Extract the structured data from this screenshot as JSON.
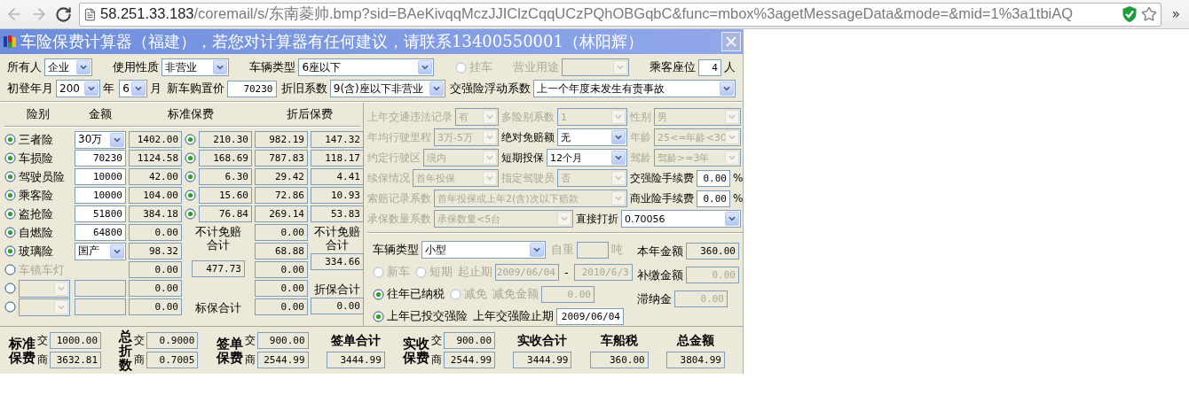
{
  "browser": {
    "url_host": "58.251.33.183",
    "url_path": "/coremail/s/东南菱帅.bmp?sid=BAeKivqqMczJJIClzCqqUCzPQhOBGqbC&func=mbox%3agetMessageData&mode=&mid=1%3a1tbiAQ",
    "overflow": "»"
  },
  "window": {
    "title": "车险保费计算器（福建），若您对计算器有任何建议，请联系13400550001（林阳辉）"
  },
  "vehicle": {
    "lines": [
      [
        {
          "kind": "select",
          "label": "所有人",
          "value": "企业",
          "disabled": false
        },
        {
          "kind": "select",
          "label": "使用性质",
          "value": "非营业",
          "disabled": false
        },
        {
          "kind": "select",
          "label": "车辆类型",
          "value": "6座以下",
          "disabled": false
        },
        {
          "kind": "radio",
          "label": "挂车",
          "selected": false,
          "disabled": true
        },
        {
          "kind": "select",
          "label": "营业用途",
          "disabled": true
        },
        {
          "kind": "input",
          "label": "乘客座位",
          "value": "4",
          "suffix": "人",
          "disabled": false
        }
      ],
      [
        {
          "kind": "select",
          "label": "初登年月",
          "value": "200",
          "suffix": "年",
          "disabled": false
        },
        {
          "kind": "select",
          "value": "6",
          "suffix": "月",
          "disabled": false
        },
        {
          "kind": "input",
          "label": "新车购置价",
          "value": "70230",
          "disabled": false
        },
        {
          "kind": "select",
          "label": "折旧系数",
          "value": "9(含)座以下非营业",
          "disabled": false
        },
        {
          "kind": "select",
          "label": "交强险浮动系数",
          "value": "上一个年度未发生有责事故",
          "disabled": false
        }
      ]
    ]
  },
  "coverage_table": {
    "columns": [
      "险别",
      "金额",
      "标准保费",
      "折后保费"
    ]
  },
  "coverages": [
    {
      "kind": "named",
      "name": "三者险",
      "selected": true,
      "disabled": false,
      "amount": {
        "kind": "select",
        "value": "30万"
      },
      "standard": "1402.00",
      "discount": {
        "selected": true,
        "value": "210.30"
      },
      "after": "982.19",
      "after_extra": "147.32"
    },
    {
      "kind": "named",
      "name": "车损险",
      "selected": true,
      "disabled": false,
      "amount": {
        "kind": "input",
        "value": "70230"
      },
      "standard": "1124.58",
      "discount": {
        "selected": true,
        "value": "168.69"
      },
      "after": "787.83",
      "after_extra": "118.17"
    },
    {
      "kind": "named",
      "name": "驾驶员险",
      "selected": true,
      "disabled": false,
      "amount": {
        "kind": "input",
        "value": "10000"
      },
      "standard": "42.00",
      "discount": {
        "selected": true,
        "value": "6.30"
      },
      "after": "29.42",
      "after_extra": "4.41"
    },
    {
      "kind": "named",
      "name": "乘客险",
      "selected": true,
      "disabled": false,
      "amount": {
        "kind": "input",
        "value": "10000"
      },
      "standard": "104.00",
      "discount": {
        "selected": true,
        "value": "15.60"
      },
      "after": "72.86",
      "after_extra": "10.93"
    },
    {
      "kind": "named",
      "name": "盗抢险",
      "selected": true,
      "disabled": false,
      "amount": {
        "kind": "input",
        "value": "51800"
      },
      "standard": "384.18",
      "discount": {
        "selected": true,
        "value": "76.84"
      },
      "after": "269.14",
      "after_extra": "53.83"
    },
    {
      "kind": "named",
      "name": "自燃险",
      "selected": true,
      "disabled": false,
      "amount": {
        "kind": "input",
        "value": "64800"
      },
      "standard": "0.00",
      "after": "0.00"
    },
    {
      "kind": "named",
      "name": "玻璃险",
      "selected": true,
      "disabled": false,
      "amount": {
        "kind": "select",
        "value": "国产"
      },
      "standard": "98.32",
      "after": "68.88"
    },
    {
      "kind": "named",
      "name": "车镜车灯",
      "selected": false,
      "disabled": true,
      "amount": {
        "kind": "none"
      },
      "standard": "0.00",
      "after": "0.00"
    },
    {
      "kind": "custom",
      "selected": false,
      "disabled": true,
      "amount": {
        "kind": "blank"
      },
      "standard": "0.00",
      "after": "0.00"
    },
    {
      "kind": "custom",
      "selected": false,
      "disabled": true,
      "amount": {
        "kind": "blank"
      },
      "standard": "0.00",
      "after": "0.00"
    }
  ],
  "standard_summary": {
    "label": "不计免赔合计",
    "value": "477.73",
    "total_label": "标保合计"
  },
  "after_summary": {
    "label": "不计免赔合计",
    "value": "334.66",
    "total_label": "折保合计",
    "total_value": "0.00"
  },
  "params": {
    "lines": [
      [
        {
          "kind": "select",
          "label": "上年交通违法记录",
          "value": "有",
          "disabled": true
        },
        {
          "kind": "select",
          "label": "多险别系数",
          "value": "1",
          "disabled": true
        },
        {
          "kind": "select",
          "label": "性别",
          "value": "男",
          "disabled": true
        }
      ],
      [
        {
          "kind": "select",
          "label": "年均行驶里程",
          "value": "3万-5万",
          "disabled": true
        },
        {
          "kind": "select",
          "label": "绝对免赔额",
          "value": "无",
          "disabled": false
        },
        {
          "kind": "select",
          "label": "年龄",
          "value": "25<=年龄<30",
          "disabled": true
        }
      ],
      [
        {
          "kind": "select",
          "label": "约定行驶区",
          "value": "境内",
          "disabled": true
        },
        {
          "kind": "select",
          "label": "短期投保",
          "value": "12个月",
          "disabled": false
        },
        {
          "kind": "select",
          "label": "驾龄",
          "value": "驾龄>=3年",
          "disabled": true
        }
      ],
      [
        {
          "kind": "select",
          "label": "续保情况",
          "value": "首年投保",
          "disabled": true
        },
        {
          "kind": "select",
          "label": "指定驾驶员",
          "value": "否",
          "disabled": true
        },
        {
          "kind": "input",
          "label": "交强险手续费",
          "value": "0.00",
          "suffix": "%",
          "disabled": false
        }
      ],
      [
        {
          "kind": "select",
          "label": "索赔记录系数",
          "value": "首年投保或上年2(含)次以下赔款",
          "disabled": true
        },
        {
          "kind": "input",
          "label": "商业险手续费",
          "value": "0.00",
          "suffix": "%",
          "disabled": false
        }
      ],
      [
        {
          "kind": "select",
          "label": "承保数量系数",
          "value": "承保数量<5台",
          "disabled": true
        },
        {
          "kind": "select",
          "label": "直接打折",
          "value": "0.70056",
          "disabled": false
        }
      ]
    ]
  },
  "tax": {
    "lines": [
      [
        {
          "kind": "select",
          "label": "车辆类型",
          "value": "小型",
          "disabled": false
        },
        {
          "kind": "input",
          "label": "自重",
          "suffix": "吨",
          "disabled": true
        }
      ],
      [
        {
          "kind": "radio",
          "label": "新车",
          "selected": false,
          "disabled": true
        },
        {
          "kind": "radio",
          "label": "短期",
          "selected": false,
          "disabled": true
        },
        {
          "kind": "input",
          "label": "起止期",
          "value": "2009/06/04",
          "disabled": true
        },
        {
          "kind": "text",
          "text": "-"
        },
        {
          "kind": "input",
          "value": "2010/6/3",
          "disabled": true
        }
      ],
      [
        {
          "kind": "radio",
          "label": "往年已纳税",
          "selected": true,
          "disabled": false
        },
        {
          "kind": "radio",
          "label": "减免",
          "selected": false,
          "disabled": true
        },
        {
          "kind": "input",
          "label": "减免金额",
          "value": "0.00",
          "disabled": true
        }
      ],
      [
        {
          "kind": "radio",
          "label": "上年已投交强险",
          "selected": true,
          "disabled": false
        },
        {
          "kind": "input",
          "label": "上年交强险止期",
          "value": "2009/06/04",
          "disabled": false
        }
      ]
    ],
    "totals": [
      {
        "label": "本年金额",
        "value": "360.00",
        "disabled": false
      },
      {
        "label": "补缴金额",
        "value": "0.00",
        "disabled": true
      },
      {
        "label": "滞纳金",
        "value": "0.00",
        "disabled": true
      }
    ]
  },
  "summary": [
    {
      "kind": "pair",
      "label": "标准保费",
      "lines": [
        {
          "label": "交",
          "value": "1000.00"
        },
        {
          "label": "商",
          "value": "3632.81"
        }
      ]
    },
    {
      "kind": "vpair",
      "label": "总折数",
      "lines": [
        {
          "label": "交",
          "value": "0.9000"
        },
        {
          "label": "商",
          "value": "0.7005"
        }
      ]
    },
    {
      "kind": "pair",
      "label": "签单保费",
      "lines": [
        {
          "label": "交",
          "value": "900.00"
        },
        {
          "label": "商",
          "value": "2544.99"
        }
      ]
    },
    {
      "kind": "total",
      "label": "签单合计",
      "value": "3444.99"
    },
    {
      "kind": "pair",
      "label": "实收保费",
      "lines": [
        {
          "label": "交",
          "value": "900.00"
        },
        {
          "label": "商",
          "value": "2544.99"
        }
      ]
    },
    {
      "kind": "total",
      "label": "实收合计",
      "value": "3444.99"
    },
    {
      "kind": "total",
      "label": "车船税",
      "value": "360.00"
    },
    {
      "kind": "total",
      "label": "总金额",
      "value": "3804.99"
    }
  ]
}
